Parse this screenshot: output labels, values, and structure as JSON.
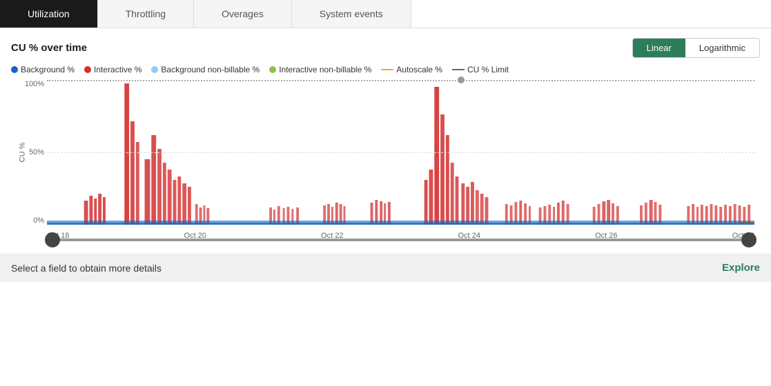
{
  "tabs": [
    {
      "label": "Utilization",
      "active": true
    },
    {
      "label": "Throttling",
      "active": false
    },
    {
      "label": "Overages",
      "active": false
    },
    {
      "label": "System events",
      "active": false
    }
  ],
  "chart": {
    "title": "CU % over time",
    "scale_linear": "Linear",
    "scale_logarithmic": "Logarithmic",
    "active_scale": "linear",
    "y_axis_label": "CU %",
    "y_ticks": [
      "100%",
      "50%",
      "0%"
    ],
    "x_ticks": [
      "Oct 18",
      "Oct 20",
      "Oct 22",
      "Oct 24",
      "Oct 26",
      "Oct 28"
    ],
    "legend": [
      {
        "type": "dot",
        "color": "#1565c0",
        "label": "Background %"
      },
      {
        "type": "dot",
        "color": "#d32f2f",
        "label": "Interactive %"
      },
      {
        "type": "dot",
        "color": "#90caf9",
        "label": "Background non-billable %"
      },
      {
        "type": "dot",
        "color": "#8bc34a",
        "label": "Interactive non-billable %"
      },
      {
        "type": "line",
        "color": "#f9a825",
        "label": "Autoscale %"
      },
      {
        "type": "line",
        "color": "#666666",
        "label": "CU % Limit"
      }
    ]
  },
  "slider": {
    "left_pos": 0,
    "right_pos": 100
  },
  "bottom": {
    "text": "Select a field to obtain more details",
    "explore": "Explore"
  }
}
